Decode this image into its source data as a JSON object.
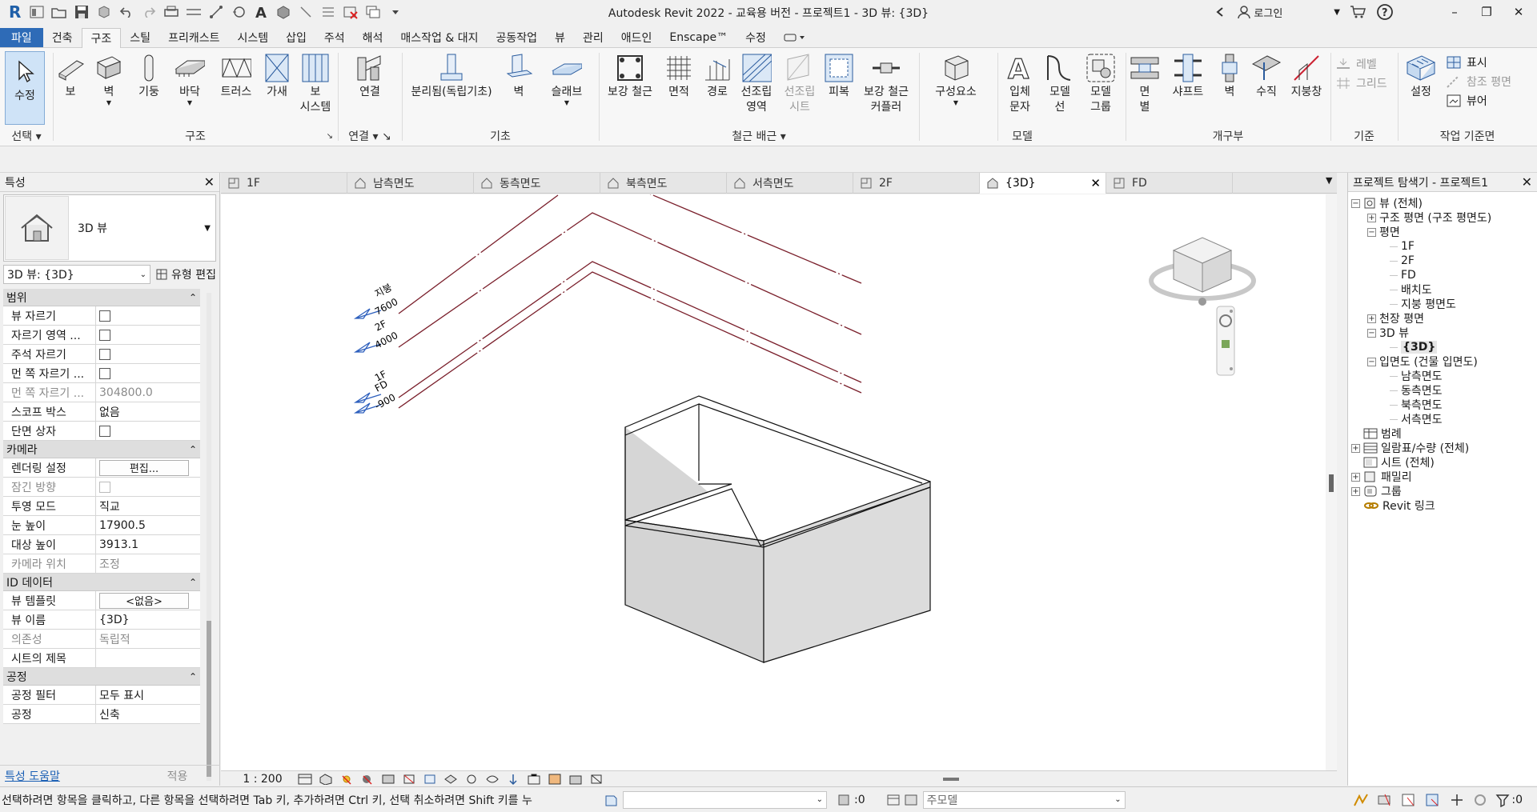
{
  "window": {
    "title": "Autodesk Revit 2022 - 교육용 버전 - 프로젝트1 - 3D 뷰: {3D}",
    "login": "로그인",
    "controls": {
      "minimize": "–",
      "restore": "❐",
      "close": "✕"
    }
  },
  "menu_tabs": [
    "파일",
    "건축",
    "구조",
    "스틸",
    "프리캐스트",
    "시스템",
    "삽입",
    "주석",
    "해석",
    "매스작업 & 대지",
    "공동작업",
    "뷰",
    "관리",
    "애드인",
    "Enscape™",
    "수정"
  ],
  "active_menu_tab": "구조",
  "ribbon": {
    "select": {
      "modify": "수정",
      "panel": "선택"
    },
    "structure": {
      "beam": "보",
      "wall": "벽",
      "column": "기둥",
      "floor": "바닥",
      "truss": "트러스",
      "brace": "가새",
      "beam_system_1": "보",
      "beam_system_2": "시스템",
      "panel": "구조"
    },
    "connection": {
      "connection": "연결",
      "panel": "연결"
    },
    "foundation": {
      "isolated": "분리됨(독립기초)",
      "wall": "벽",
      "slab": "슬래브",
      "panel": "기초"
    },
    "rebar": {
      "rebar": "보강 철근",
      "area": "면적",
      "path": "경로",
      "fabric_area_1": "선조립",
      "fabric_area_2": "영역",
      "fabric_sheet_1": "선조립",
      "fabric_sheet_2": "시트",
      "cover": "피복",
      "coupler_1": "보강 철근",
      "coupler_2": "커플러",
      "panel": "철근 배근"
    },
    "model": {
      "component": "구성요소",
      "model_text_1": "입체",
      "model_text_2": "문자",
      "model_line_1": "모델",
      "model_line_2": "선",
      "model_group_1": "모델",
      "model_group_2": "그룹",
      "panel": "모델"
    },
    "opening": {
      "by_face_1": "면",
      "by_face_2": "별",
      "shaft": "샤프트",
      "wall": "벽",
      "vertical": "수직",
      "dormer": "지붕창",
      "panel": "개구부"
    },
    "datum": {
      "level": "레벨",
      "grid": "그리드",
      "panel": "기준"
    },
    "work_plane": {
      "set": "설정",
      "show": "표시",
      "ref_plane": "참조 평면",
      "viewer": "뷰어",
      "panel": "작업 기준면"
    }
  },
  "properties": {
    "title": "특성",
    "type_name": "3D 뷰",
    "instance_selector": "3D 뷰: {3D}",
    "edit_type": "유형 편집",
    "sections": [
      {
        "name": "범위",
        "rows": [
          {
            "k": "뷰 자르기",
            "t": "cb"
          },
          {
            "k": "자르기 영역 ...",
            "t": "cb"
          },
          {
            "k": "주석 자르기",
            "t": "cb"
          },
          {
            "k": "먼 쪽 자르기 ...",
            "t": "cb"
          },
          {
            "k": "먼 쪽 자르기 ...",
            "v": "304800.0",
            "dis": true
          },
          {
            "k": "스코프 박스",
            "v": "없음"
          },
          {
            "k": "단면 상자",
            "t": "cb"
          }
        ]
      },
      {
        "name": "카메라",
        "rows": [
          {
            "k": "렌더링 설정",
            "t": "btn",
            "v": "편집..."
          },
          {
            "k": "잠긴 방향",
            "t": "cb",
            "dis": true
          },
          {
            "k": "투영 모드",
            "v": "직교"
          },
          {
            "k": "눈 높이",
            "v": "17900.5"
          },
          {
            "k": "대상 높이",
            "v": "3913.1"
          },
          {
            "k": "카메라 위치",
            "v": "조정",
            "dis": true
          }
        ]
      },
      {
        "name": "ID 데이터",
        "rows": [
          {
            "k": "뷰 템플릿",
            "t": "btn",
            "v": "<없음>"
          },
          {
            "k": "뷰 이름",
            "v": "{3D}"
          },
          {
            "k": "의존성",
            "v": "독립적",
            "dis": true
          },
          {
            "k": "시트의 제목",
            "v": ""
          }
        ]
      },
      {
        "name": "공정",
        "rows": [
          {
            "k": "공정 필터",
            "v": "모두 표시"
          },
          {
            "k": "공정",
            "v": "신축"
          }
        ]
      }
    ],
    "help": "특성 도움말",
    "apply": "적용"
  },
  "view_tabs": [
    {
      "label": "1F",
      "icon": "floor-plan-icon"
    },
    {
      "label": "남측면도",
      "icon": "elevation-icon"
    },
    {
      "label": "동측면도",
      "icon": "elevation-icon"
    },
    {
      "label": "북측면도",
      "icon": "elevation-icon"
    },
    {
      "label": "서측면도",
      "icon": "elevation-icon"
    },
    {
      "label": "2F",
      "icon": "floor-plan-icon"
    },
    {
      "label": "{3D}",
      "icon": "3d-view-icon",
      "active": true
    },
    {
      "label": "FD",
      "icon": "floor-plan-icon"
    }
  ],
  "levels": [
    {
      "name": "지붕",
      "elev": "7600"
    },
    {
      "name": "2F",
      "elev": "4000"
    },
    {
      "name": "1F",
      "elev": ""
    },
    {
      "name": "FD",
      "elev": "-900"
    }
  ],
  "view_control": {
    "scale": "1 : 200"
  },
  "browser": {
    "title": "프로젝트 탐색기 - 프로젝트1",
    "nodes": [
      {
        "label": "뷰 (전체)",
        "depth": 0,
        "tog": "−",
        "icon": "views"
      },
      {
        "label": "구조 평면 (구조 평면도)",
        "depth": 1,
        "tog": "+"
      },
      {
        "label": "평면",
        "depth": 1,
        "tog": "−"
      },
      {
        "label": "1F",
        "depth": 2
      },
      {
        "label": "2F",
        "depth": 2
      },
      {
        "label": "FD",
        "depth": 2
      },
      {
        "label": "배치도",
        "depth": 2
      },
      {
        "label": "지붕 평면도",
        "depth": 2
      },
      {
        "label": "천장 평면",
        "depth": 1,
        "tog": "+"
      },
      {
        "label": "3D 뷰",
        "depth": 1,
        "tog": "−"
      },
      {
        "label": "{3D}",
        "depth": 2,
        "bold": true
      },
      {
        "label": "입면도 (건물 입면도)",
        "depth": 1,
        "tog": "−"
      },
      {
        "label": "남측면도",
        "depth": 2
      },
      {
        "label": "동측면도",
        "depth": 2
      },
      {
        "label": "북측면도",
        "depth": 2
      },
      {
        "label": "서측면도",
        "depth": 2
      },
      {
        "label": "범례",
        "depth": 0,
        "icon": "legend"
      },
      {
        "label": "일람표/수량 (전체)",
        "depth": 0,
        "tog": "+",
        "icon": "schedule"
      },
      {
        "label": "시트 (전체)",
        "depth": 0,
        "icon": "sheet"
      },
      {
        "label": "패밀리",
        "depth": 0,
        "tog": "+",
        "icon": "family"
      },
      {
        "label": "그룹",
        "depth": 0,
        "tog": "+",
        "icon": "group"
      },
      {
        "label": "Revit 링크",
        "depth": 0,
        "icon": "link"
      }
    ]
  },
  "status": {
    "message": "선택하려면 항목을 클릭하고, 다른 항목을 선택하려면 Tab 키, 추가하려면 Ctrl 키, 선택 취소하려면 Shift 키를 누",
    "count": ":0",
    "model": "주모델",
    "filter_count": ":0"
  },
  "colors": {
    "file_tab": "#2e6bb7",
    "level_line": "#7a1f2b",
    "level_marker": "#2d5fbd",
    "selection": "#cfe3f7"
  }
}
